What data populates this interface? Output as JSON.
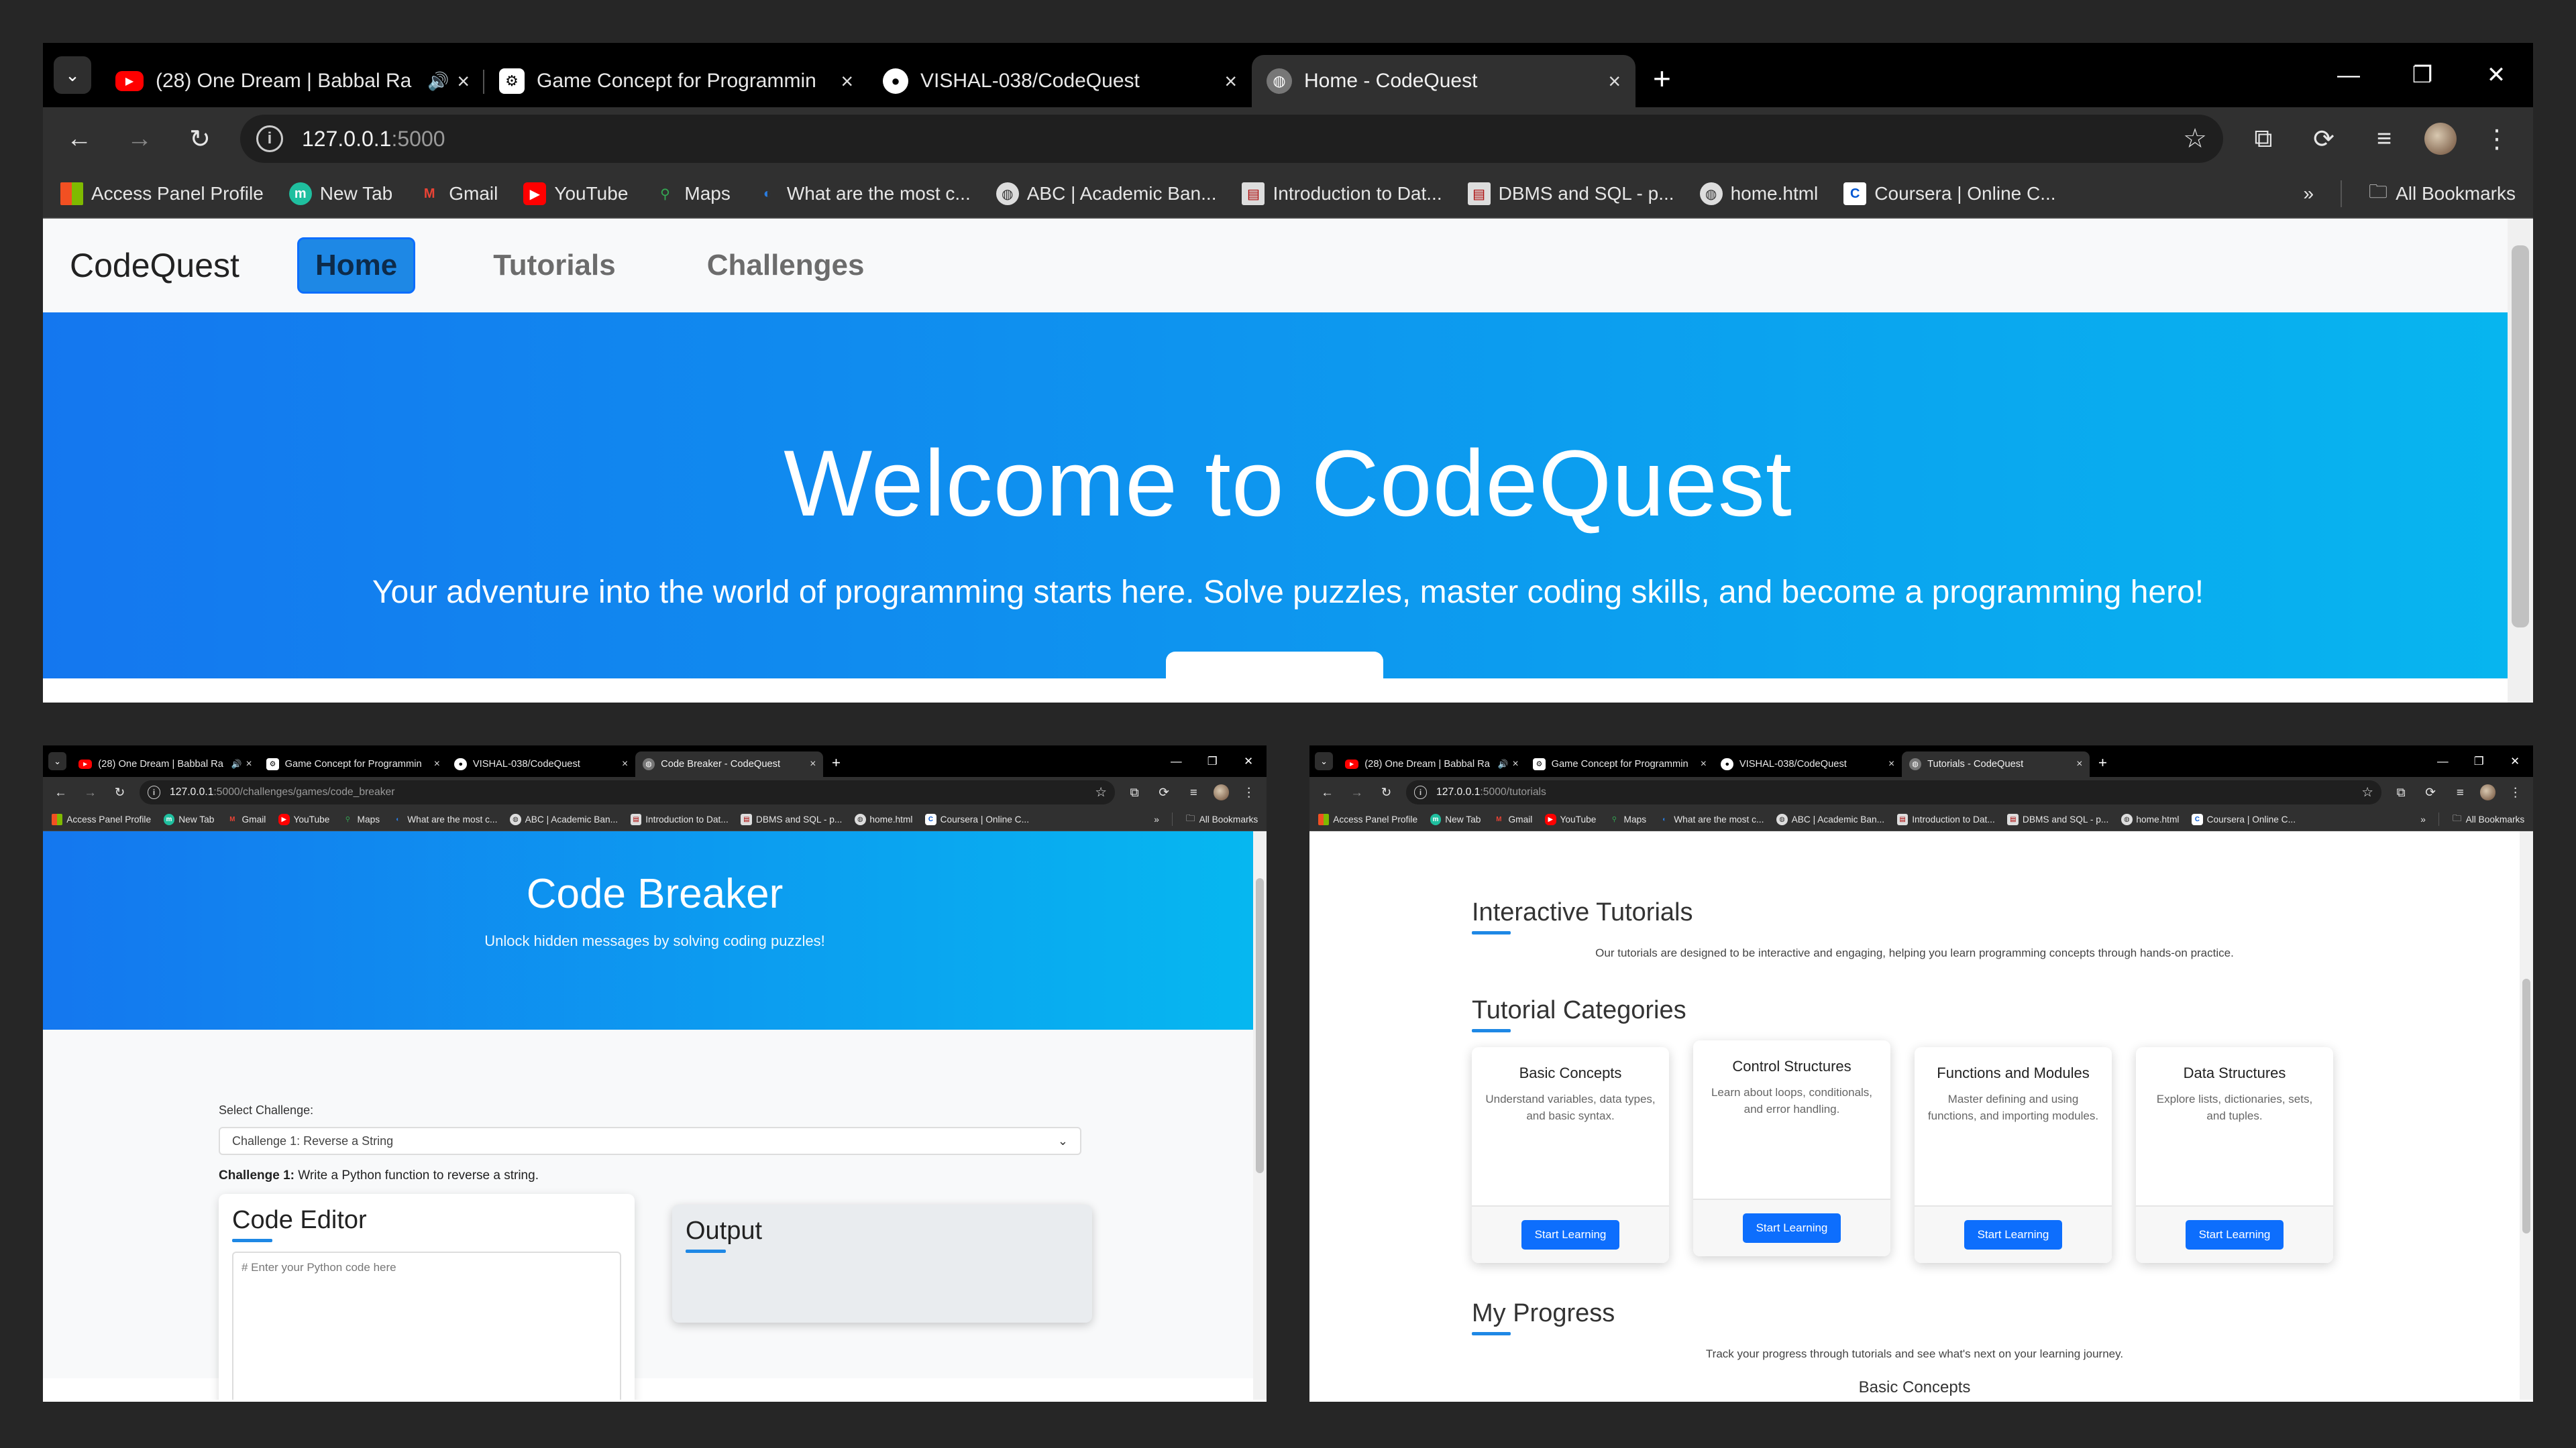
{
  "tabs": [
    {
      "title": "(28) One Dream | Babbal Ra",
      "favicon": "youtube-icon",
      "audio": true
    },
    {
      "title": "Game Concept for Programmin",
      "favicon": "chatgpt-icon"
    },
    {
      "title": "VISHAL-038/CodeQuest",
      "favicon": "github-icon"
    }
  ],
  "bookmarks": [
    {
      "label": "Access Panel Profile",
      "icon": "microsoft-icon"
    },
    {
      "label": "New Tab",
      "icon": "new-tab-icon"
    },
    {
      "label": "Gmail",
      "icon": "gmail-icon"
    },
    {
      "label": "YouTube",
      "icon": "youtube-icon"
    },
    {
      "label": "Maps",
      "icon": "maps-icon"
    },
    {
      "label": "What are the most c...",
      "icon": "edge-icon"
    },
    {
      "label": "ABC | Academic Ban...",
      "icon": "globe-icon"
    },
    {
      "label": "Introduction to Dat...",
      "icon": "doc-icon"
    },
    {
      "label": "DBMS and SQL - p...",
      "icon": "doc-icon"
    },
    {
      "label": "home.html",
      "icon": "globe-icon"
    },
    {
      "label": "Coursera | Online C...",
      "icon": "coursera-icon"
    }
  ],
  "all_bookmarks": "All Bookmarks",
  "overflow": "»",
  "home_window": {
    "active_tab": "Home - CodeQuest",
    "url_host": "127.0.0.1",
    "url_rest": ":5000",
    "brand": "CodeQuest",
    "nav": [
      "Home",
      "Tutorials",
      "Challenges"
    ],
    "hero_title": "Welcome to CodeQuest",
    "hero_subtitle": "Your adventure into the world of programming starts here. Solve puzzles, master coding skills, and become a programming hero!"
  },
  "code_breaker_window": {
    "active_tab": "Code Breaker - CodeQuest",
    "url_host": "127.0.0.1",
    "url_rest": ":5000/challenges/games/code_breaker",
    "title": "Code Breaker",
    "subtitle": "Unlock hidden messages by solving coding puzzles!",
    "select_label": "Select Challenge:",
    "selected_challenge": "Challenge 1: Reverse a String",
    "challenge_prefix": "Challenge 1:",
    "challenge_text": " Write a Python function to reverse a string.",
    "editor_title": "Code Editor",
    "editor_placeholder": "# Enter your Python code here",
    "output_title": "Output"
  },
  "tutorials_window": {
    "active_tab": "Tutorials - CodeQuest",
    "url_host": "127.0.0.1",
    "url_rest": ":5000/tutorials",
    "interactive_title": "Interactive Tutorials",
    "interactive_desc": "Our tutorials are designed to be interactive and engaging, helping you learn programming concepts through hands-on practice.",
    "categories_title": "Tutorial Categories",
    "cards": [
      {
        "title": "Basic Concepts",
        "text": "Understand variables, data types, and basic syntax.",
        "button": "Start Learning"
      },
      {
        "title": "Control Structures",
        "text": "Learn about loops, conditionals, and error handling.",
        "button": "Start Learning"
      },
      {
        "title": "Functions and Modules",
        "text": "Master defining and using functions, and importing modules.",
        "button": "Start Learning"
      },
      {
        "title": "Data Structures",
        "text": "Explore lists, dictionaries, sets, and tuples.",
        "button": "Start Learning"
      }
    ],
    "progress_title": "My Progress",
    "progress_desc": "Track your progress through tutorials and see what's next on your learning journey.",
    "progress_next": "Basic Concepts"
  },
  "colors": {
    "accent": "#0d6efd",
    "hero_start": "#1477ef",
    "hero_end": "#07b6ef",
    "chrome_dark": "#303030"
  }
}
